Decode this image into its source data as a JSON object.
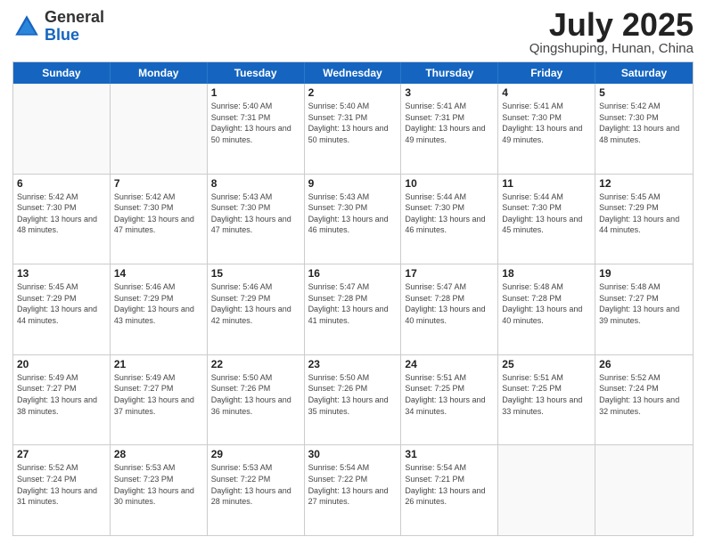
{
  "logo": {
    "general": "General",
    "blue": "Blue"
  },
  "title": "July 2025",
  "subtitle": "Qingshuping, Hunan, China",
  "days_of_week": [
    "Sunday",
    "Monday",
    "Tuesday",
    "Wednesday",
    "Thursday",
    "Friday",
    "Saturday"
  ],
  "weeks": [
    [
      {
        "day": "",
        "sunrise": "",
        "sunset": "",
        "daylight": "",
        "empty": true
      },
      {
        "day": "",
        "sunrise": "",
        "sunset": "",
        "daylight": "",
        "empty": true
      },
      {
        "day": "1",
        "sunrise": "Sunrise: 5:40 AM",
        "sunset": "Sunset: 7:31 PM",
        "daylight": "Daylight: 13 hours and 50 minutes."
      },
      {
        "day": "2",
        "sunrise": "Sunrise: 5:40 AM",
        "sunset": "Sunset: 7:31 PM",
        "daylight": "Daylight: 13 hours and 50 minutes."
      },
      {
        "day": "3",
        "sunrise": "Sunrise: 5:41 AM",
        "sunset": "Sunset: 7:31 PM",
        "daylight": "Daylight: 13 hours and 49 minutes."
      },
      {
        "day": "4",
        "sunrise": "Sunrise: 5:41 AM",
        "sunset": "Sunset: 7:30 PM",
        "daylight": "Daylight: 13 hours and 49 minutes."
      },
      {
        "day": "5",
        "sunrise": "Sunrise: 5:42 AM",
        "sunset": "Sunset: 7:30 PM",
        "daylight": "Daylight: 13 hours and 48 minutes."
      }
    ],
    [
      {
        "day": "6",
        "sunrise": "Sunrise: 5:42 AM",
        "sunset": "Sunset: 7:30 PM",
        "daylight": "Daylight: 13 hours and 48 minutes."
      },
      {
        "day": "7",
        "sunrise": "Sunrise: 5:42 AM",
        "sunset": "Sunset: 7:30 PM",
        "daylight": "Daylight: 13 hours and 47 minutes."
      },
      {
        "day": "8",
        "sunrise": "Sunrise: 5:43 AM",
        "sunset": "Sunset: 7:30 PM",
        "daylight": "Daylight: 13 hours and 47 minutes."
      },
      {
        "day": "9",
        "sunrise": "Sunrise: 5:43 AM",
        "sunset": "Sunset: 7:30 PM",
        "daylight": "Daylight: 13 hours and 46 minutes."
      },
      {
        "day": "10",
        "sunrise": "Sunrise: 5:44 AM",
        "sunset": "Sunset: 7:30 PM",
        "daylight": "Daylight: 13 hours and 46 minutes."
      },
      {
        "day": "11",
        "sunrise": "Sunrise: 5:44 AM",
        "sunset": "Sunset: 7:30 PM",
        "daylight": "Daylight: 13 hours and 45 minutes."
      },
      {
        "day": "12",
        "sunrise": "Sunrise: 5:45 AM",
        "sunset": "Sunset: 7:29 PM",
        "daylight": "Daylight: 13 hours and 44 minutes."
      }
    ],
    [
      {
        "day": "13",
        "sunrise": "Sunrise: 5:45 AM",
        "sunset": "Sunset: 7:29 PM",
        "daylight": "Daylight: 13 hours and 44 minutes."
      },
      {
        "day": "14",
        "sunrise": "Sunrise: 5:46 AM",
        "sunset": "Sunset: 7:29 PM",
        "daylight": "Daylight: 13 hours and 43 minutes."
      },
      {
        "day": "15",
        "sunrise": "Sunrise: 5:46 AM",
        "sunset": "Sunset: 7:29 PM",
        "daylight": "Daylight: 13 hours and 42 minutes."
      },
      {
        "day": "16",
        "sunrise": "Sunrise: 5:47 AM",
        "sunset": "Sunset: 7:28 PM",
        "daylight": "Daylight: 13 hours and 41 minutes."
      },
      {
        "day": "17",
        "sunrise": "Sunrise: 5:47 AM",
        "sunset": "Sunset: 7:28 PM",
        "daylight": "Daylight: 13 hours and 40 minutes."
      },
      {
        "day": "18",
        "sunrise": "Sunrise: 5:48 AM",
        "sunset": "Sunset: 7:28 PM",
        "daylight": "Daylight: 13 hours and 40 minutes."
      },
      {
        "day": "19",
        "sunrise": "Sunrise: 5:48 AM",
        "sunset": "Sunset: 7:27 PM",
        "daylight": "Daylight: 13 hours and 39 minutes."
      }
    ],
    [
      {
        "day": "20",
        "sunrise": "Sunrise: 5:49 AM",
        "sunset": "Sunset: 7:27 PM",
        "daylight": "Daylight: 13 hours and 38 minutes."
      },
      {
        "day": "21",
        "sunrise": "Sunrise: 5:49 AM",
        "sunset": "Sunset: 7:27 PM",
        "daylight": "Daylight: 13 hours and 37 minutes."
      },
      {
        "day": "22",
        "sunrise": "Sunrise: 5:50 AM",
        "sunset": "Sunset: 7:26 PM",
        "daylight": "Daylight: 13 hours and 36 minutes."
      },
      {
        "day": "23",
        "sunrise": "Sunrise: 5:50 AM",
        "sunset": "Sunset: 7:26 PM",
        "daylight": "Daylight: 13 hours and 35 minutes."
      },
      {
        "day": "24",
        "sunrise": "Sunrise: 5:51 AM",
        "sunset": "Sunset: 7:25 PM",
        "daylight": "Daylight: 13 hours and 34 minutes."
      },
      {
        "day": "25",
        "sunrise": "Sunrise: 5:51 AM",
        "sunset": "Sunset: 7:25 PM",
        "daylight": "Daylight: 13 hours and 33 minutes."
      },
      {
        "day": "26",
        "sunrise": "Sunrise: 5:52 AM",
        "sunset": "Sunset: 7:24 PM",
        "daylight": "Daylight: 13 hours and 32 minutes."
      }
    ],
    [
      {
        "day": "27",
        "sunrise": "Sunrise: 5:52 AM",
        "sunset": "Sunset: 7:24 PM",
        "daylight": "Daylight: 13 hours and 31 minutes."
      },
      {
        "day": "28",
        "sunrise": "Sunrise: 5:53 AM",
        "sunset": "Sunset: 7:23 PM",
        "daylight": "Daylight: 13 hours and 30 minutes."
      },
      {
        "day": "29",
        "sunrise": "Sunrise: 5:53 AM",
        "sunset": "Sunset: 7:22 PM",
        "daylight": "Daylight: 13 hours and 28 minutes."
      },
      {
        "day": "30",
        "sunrise": "Sunrise: 5:54 AM",
        "sunset": "Sunset: 7:22 PM",
        "daylight": "Daylight: 13 hours and 27 minutes."
      },
      {
        "day": "31",
        "sunrise": "Sunrise: 5:54 AM",
        "sunset": "Sunset: 7:21 PM",
        "daylight": "Daylight: 13 hours and 26 minutes."
      },
      {
        "day": "",
        "sunrise": "",
        "sunset": "",
        "daylight": "",
        "empty": true
      },
      {
        "day": "",
        "sunrise": "",
        "sunset": "",
        "daylight": "",
        "empty": true
      }
    ]
  ]
}
